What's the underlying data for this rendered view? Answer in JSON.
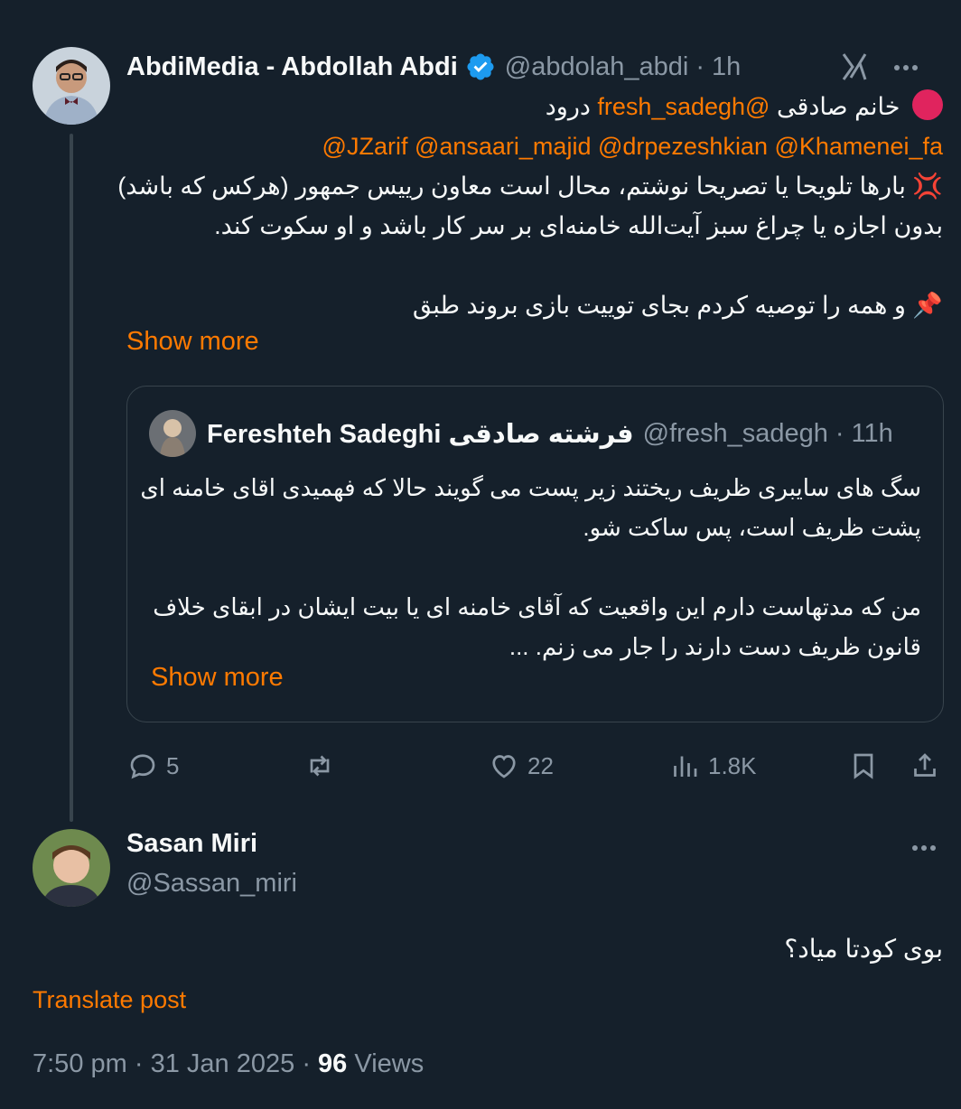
{
  "tweet": {
    "author_name": "AbdiMedia - Abdollah Abdi",
    "handle": "@abdolah_abdi",
    "separator": "·",
    "time": "1h",
    "lines": {
      "l1_text": "خانم صادقی",
      "l1_mention": "@fresh_sadegh",
      "l1_tail": "درود",
      "mentions_line": "@JZarif @ansaari_majid @drpezeshkian @Khamenei_fa",
      "l3": "💢 بارها تلویحا یا تصریحا نوشتم، محال است معاون رییس جمهور (هرکس که باشد)",
      "l4": "بدون اجازه یا چراغ سبز آیت‌الله خامنه‌ای بر سر کار باشد و او سکوت کند.",
      "l5": "📌 و همه را توصیه کردم بجای توییت بازی بروند طبق"
    },
    "show_more": "Show more"
  },
  "quote": {
    "author_name": "Fereshteh Sadeghi فرشته صادقی",
    "handle": "@fresh_sadegh",
    "separator": "·",
    "time": "11h",
    "lines": [
      "سگ های سایبری ظریف ریختند زیر پست می گویند حالا که فهمیدی اقای خامنه ای",
      "پشت ظریف است، پس ساکت شو.",
      "",
      "من که مدتهاست دارم این واقعیت که آقای خامنه ای یا بیت ایشان در ابقای خلاف",
      "قانون ظریف دست دارند را جار می زنم. ..."
    ],
    "show_more": "Show more"
  },
  "actions": {
    "replies": "5",
    "reposts": "",
    "likes": "22",
    "views": "1.8K"
  },
  "reply": {
    "author_name": "Sasan Miri",
    "handle": "@Sassan_miri",
    "text": "بوی کودتا میاد؟",
    "translate": "Translate post",
    "time": "7:50 pm",
    "separator": "·",
    "date": "31 Jan 2025",
    "views_count": "96",
    "views_label": "Views"
  },
  "colors": {
    "background": "#15202b",
    "accent": "#ff7a00",
    "verified": "#1d9bf0",
    "secondary_text": "#8b98a5",
    "border": "#38444d"
  }
}
